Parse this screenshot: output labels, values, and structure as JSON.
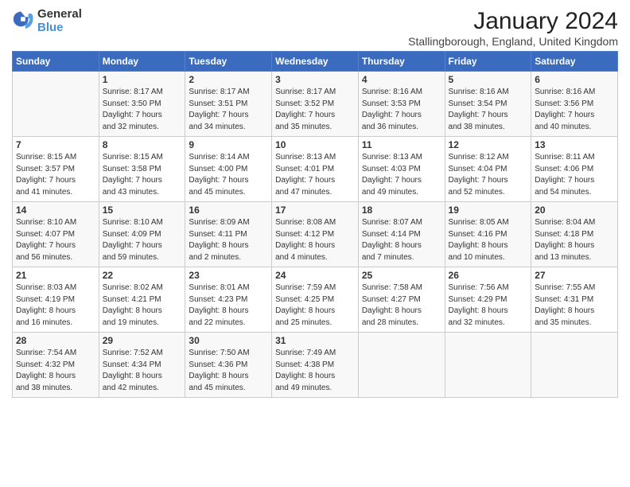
{
  "header": {
    "logo_general": "General",
    "logo_blue": "Blue",
    "title": "January 2024",
    "subtitle": "Stallingborough, England, United Kingdom"
  },
  "days_of_week": [
    "Sunday",
    "Monday",
    "Tuesday",
    "Wednesday",
    "Thursday",
    "Friday",
    "Saturday"
  ],
  "weeks": [
    [
      {
        "day": "",
        "detail": ""
      },
      {
        "day": "1",
        "detail": "Sunrise: 8:17 AM\nSunset: 3:50 PM\nDaylight: 7 hours\nand 32 minutes."
      },
      {
        "day": "2",
        "detail": "Sunrise: 8:17 AM\nSunset: 3:51 PM\nDaylight: 7 hours\nand 34 minutes."
      },
      {
        "day": "3",
        "detail": "Sunrise: 8:17 AM\nSunset: 3:52 PM\nDaylight: 7 hours\nand 35 minutes."
      },
      {
        "day": "4",
        "detail": "Sunrise: 8:16 AM\nSunset: 3:53 PM\nDaylight: 7 hours\nand 36 minutes."
      },
      {
        "day": "5",
        "detail": "Sunrise: 8:16 AM\nSunset: 3:54 PM\nDaylight: 7 hours\nand 38 minutes."
      },
      {
        "day": "6",
        "detail": "Sunrise: 8:16 AM\nSunset: 3:56 PM\nDaylight: 7 hours\nand 40 minutes."
      }
    ],
    [
      {
        "day": "7",
        "detail": "Sunrise: 8:15 AM\nSunset: 3:57 PM\nDaylight: 7 hours\nand 41 minutes."
      },
      {
        "day": "8",
        "detail": "Sunrise: 8:15 AM\nSunset: 3:58 PM\nDaylight: 7 hours\nand 43 minutes."
      },
      {
        "day": "9",
        "detail": "Sunrise: 8:14 AM\nSunset: 4:00 PM\nDaylight: 7 hours\nand 45 minutes."
      },
      {
        "day": "10",
        "detail": "Sunrise: 8:13 AM\nSunset: 4:01 PM\nDaylight: 7 hours\nand 47 minutes."
      },
      {
        "day": "11",
        "detail": "Sunrise: 8:13 AM\nSunset: 4:03 PM\nDaylight: 7 hours\nand 49 minutes."
      },
      {
        "day": "12",
        "detail": "Sunrise: 8:12 AM\nSunset: 4:04 PM\nDaylight: 7 hours\nand 52 minutes."
      },
      {
        "day": "13",
        "detail": "Sunrise: 8:11 AM\nSunset: 4:06 PM\nDaylight: 7 hours\nand 54 minutes."
      }
    ],
    [
      {
        "day": "14",
        "detail": "Sunrise: 8:10 AM\nSunset: 4:07 PM\nDaylight: 7 hours\nand 56 minutes."
      },
      {
        "day": "15",
        "detail": "Sunrise: 8:10 AM\nSunset: 4:09 PM\nDaylight: 7 hours\nand 59 minutes."
      },
      {
        "day": "16",
        "detail": "Sunrise: 8:09 AM\nSunset: 4:11 PM\nDaylight: 8 hours\nand 2 minutes."
      },
      {
        "day": "17",
        "detail": "Sunrise: 8:08 AM\nSunset: 4:12 PM\nDaylight: 8 hours\nand 4 minutes."
      },
      {
        "day": "18",
        "detail": "Sunrise: 8:07 AM\nSunset: 4:14 PM\nDaylight: 8 hours\nand 7 minutes."
      },
      {
        "day": "19",
        "detail": "Sunrise: 8:05 AM\nSunset: 4:16 PM\nDaylight: 8 hours\nand 10 minutes."
      },
      {
        "day": "20",
        "detail": "Sunrise: 8:04 AM\nSunset: 4:18 PM\nDaylight: 8 hours\nand 13 minutes."
      }
    ],
    [
      {
        "day": "21",
        "detail": "Sunrise: 8:03 AM\nSunset: 4:19 PM\nDaylight: 8 hours\nand 16 minutes."
      },
      {
        "day": "22",
        "detail": "Sunrise: 8:02 AM\nSunset: 4:21 PM\nDaylight: 8 hours\nand 19 minutes."
      },
      {
        "day": "23",
        "detail": "Sunrise: 8:01 AM\nSunset: 4:23 PM\nDaylight: 8 hours\nand 22 minutes."
      },
      {
        "day": "24",
        "detail": "Sunrise: 7:59 AM\nSunset: 4:25 PM\nDaylight: 8 hours\nand 25 minutes."
      },
      {
        "day": "25",
        "detail": "Sunrise: 7:58 AM\nSunset: 4:27 PM\nDaylight: 8 hours\nand 28 minutes."
      },
      {
        "day": "26",
        "detail": "Sunrise: 7:56 AM\nSunset: 4:29 PM\nDaylight: 8 hours\nand 32 minutes."
      },
      {
        "day": "27",
        "detail": "Sunrise: 7:55 AM\nSunset: 4:31 PM\nDaylight: 8 hours\nand 35 minutes."
      }
    ],
    [
      {
        "day": "28",
        "detail": "Sunrise: 7:54 AM\nSunset: 4:32 PM\nDaylight: 8 hours\nand 38 minutes."
      },
      {
        "day": "29",
        "detail": "Sunrise: 7:52 AM\nSunset: 4:34 PM\nDaylight: 8 hours\nand 42 minutes."
      },
      {
        "day": "30",
        "detail": "Sunrise: 7:50 AM\nSunset: 4:36 PM\nDaylight: 8 hours\nand 45 minutes."
      },
      {
        "day": "31",
        "detail": "Sunrise: 7:49 AM\nSunset: 4:38 PM\nDaylight: 8 hours\nand 49 minutes."
      },
      {
        "day": "",
        "detail": ""
      },
      {
        "day": "",
        "detail": ""
      },
      {
        "day": "",
        "detail": ""
      }
    ]
  ]
}
